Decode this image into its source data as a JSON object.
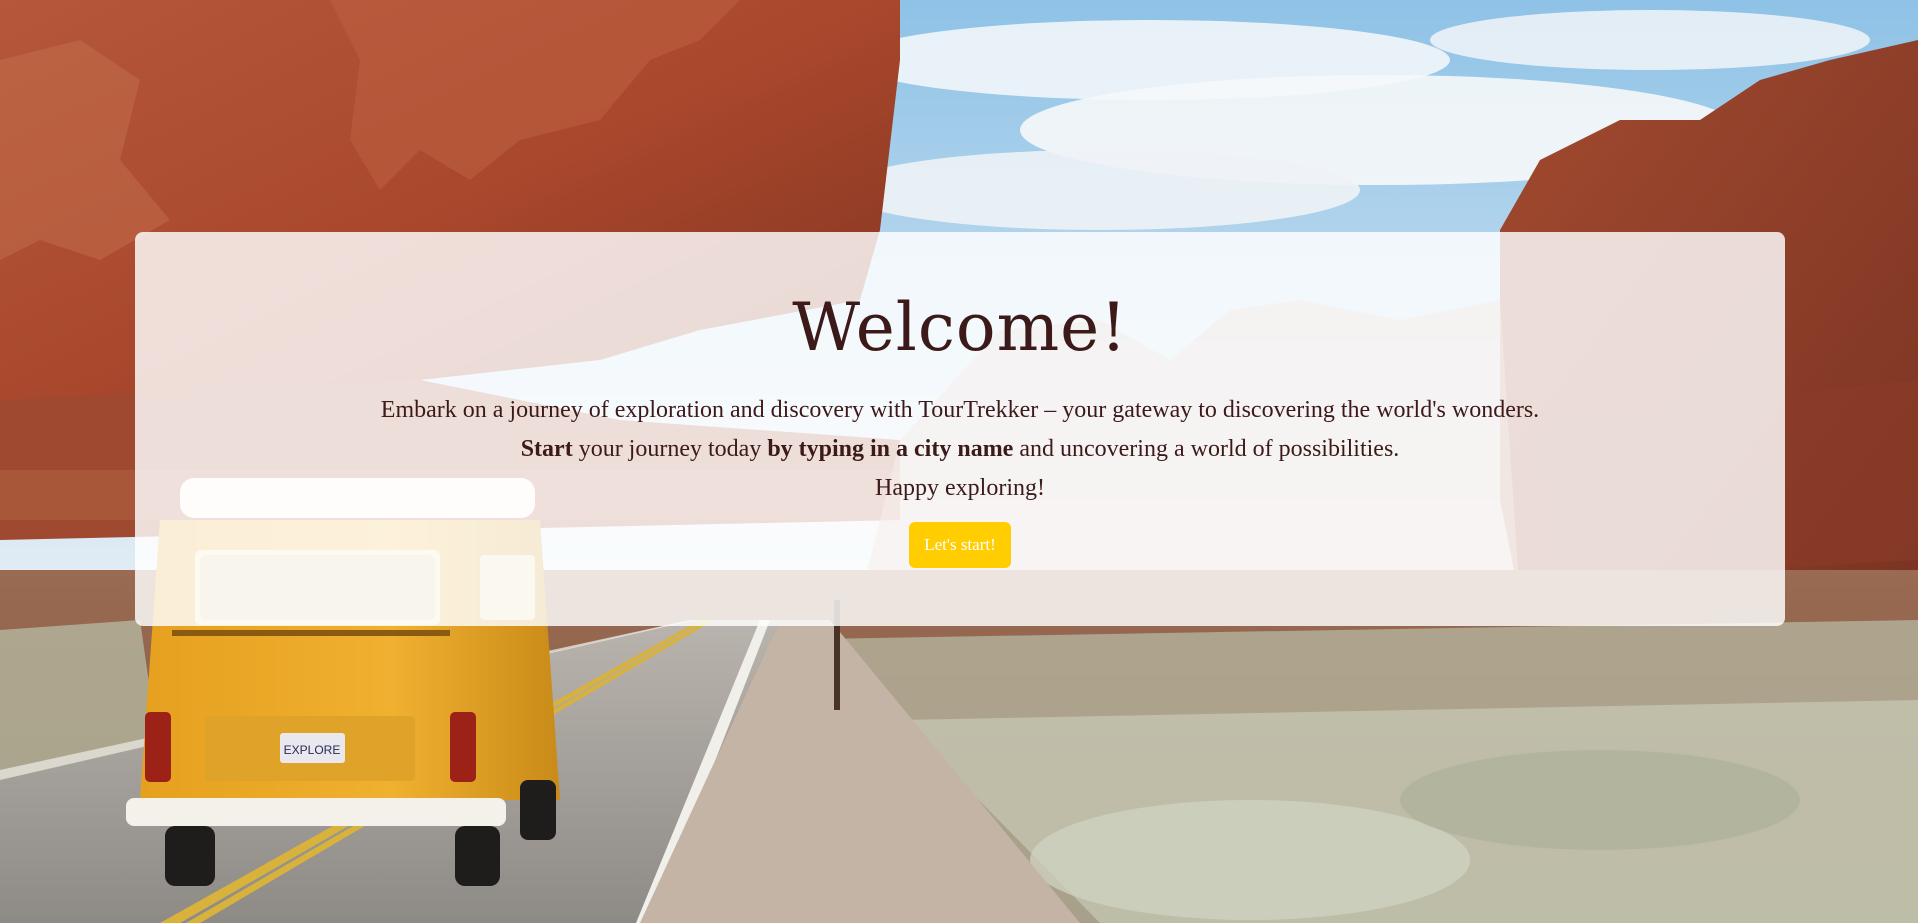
{
  "hero": {
    "background_image": "desert-road-van-photo",
    "plate_text": "EXPLORE"
  },
  "welcome": {
    "title": "Welcome!",
    "line1": "Embark on a journey of exploration and discovery with TourTrekker – your gateway to discovering the world's wonders.",
    "line2_bold_start": "Start",
    "line2_mid": " your journey today ",
    "line2_bold_city": "by typing in a city name",
    "line2_end": " and uncovering a world of possibilities.",
    "line3": "Happy exploring!",
    "button_label": "Let's start!"
  },
  "colors": {
    "title_text": "#3d1a1a",
    "button_bg": "#ffcd00",
    "button_text": "#ffffff",
    "panel_bg": "rgba(255,255,255,0.82)"
  }
}
